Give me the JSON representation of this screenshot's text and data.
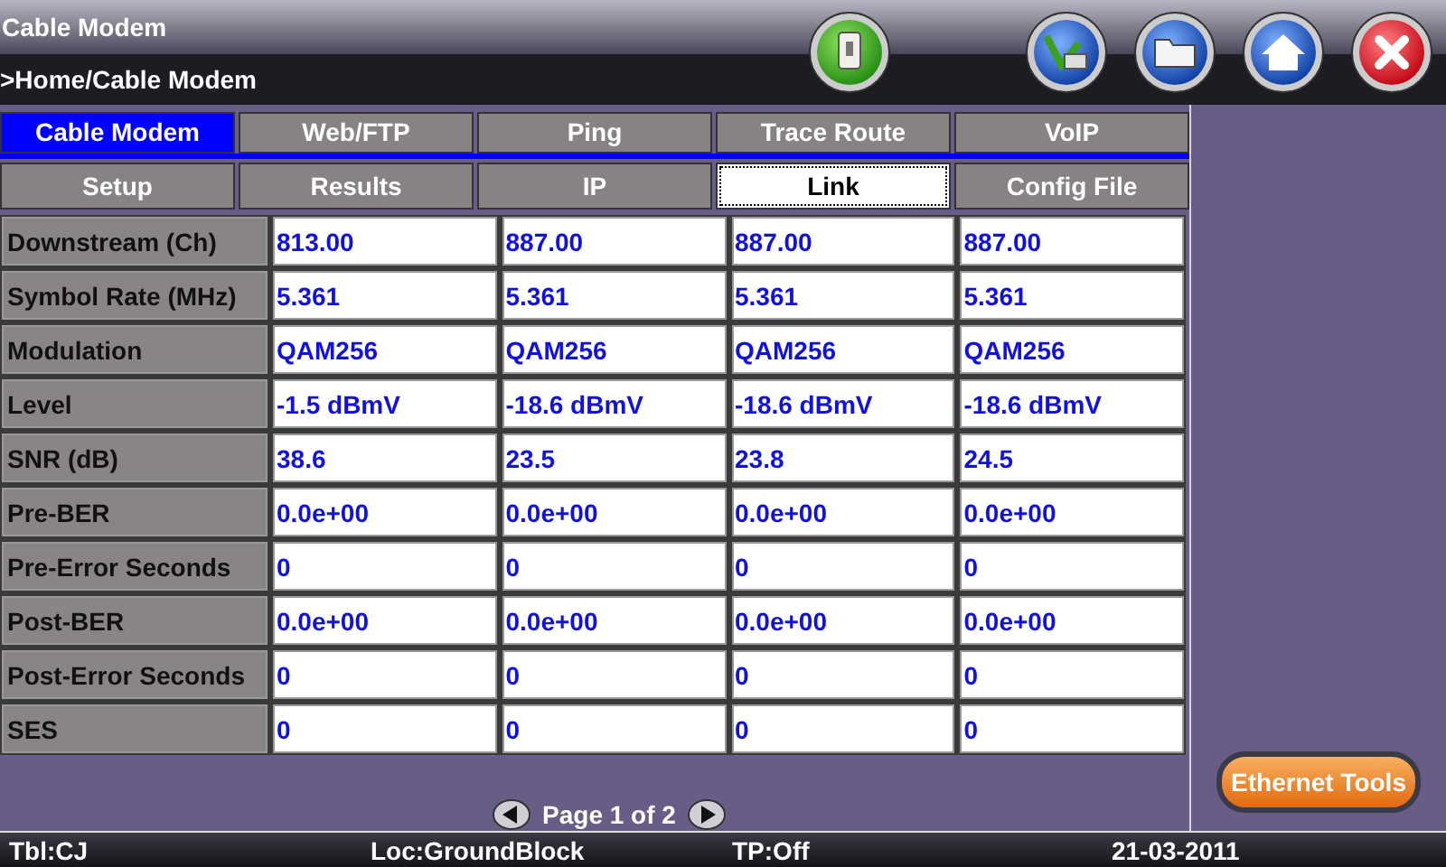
{
  "window": {
    "title": "Cable Modem",
    "breadcrumb": ">Home/Cable Modem"
  },
  "tabs": [
    {
      "label": "Cable Modem",
      "selected": true
    },
    {
      "label": "Web/FTP",
      "selected": false
    },
    {
      "label": "Ping",
      "selected": false
    },
    {
      "label": "Trace Route",
      "selected": false
    },
    {
      "label": "VoIP",
      "selected": false
    }
  ],
  "subtabs": [
    {
      "label": "Setup",
      "selected": false
    },
    {
      "label": "Results",
      "selected": false
    },
    {
      "label": "IP",
      "selected": false
    },
    {
      "label": "Link",
      "selected": true
    },
    {
      "label": "Config File",
      "selected": false
    }
  ],
  "table": {
    "rows": [
      {
        "label": "Downstream (Ch)",
        "cells": [
          "813.00",
          "887.00",
          "887.00",
          "887.00"
        ]
      },
      {
        "label": "Symbol Rate (MHz)",
        "cells": [
          "5.361",
          "5.361",
          "5.361",
          "5.361"
        ]
      },
      {
        "label": "Modulation",
        "cells": [
          "QAM256",
          "QAM256",
          "QAM256",
          "QAM256"
        ]
      },
      {
        "label": "Level",
        "cells": [
          "-1.5 dBmV",
          "-18.6 dBmV",
          "-18.6 dBmV",
          "-18.6 dBmV"
        ]
      },
      {
        "label": "SNR (dB)",
        "cells": [
          "38.6",
          "23.5",
          "23.8",
          "24.5"
        ]
      },
      {
        "label": "Pre-BER",
        "cells": [
          "0.0e+00",
          "0.0e+00",
          "0.0e+00",
          "0.0e+00"
        ]
      },
      {
        "label": "Pre-Error Seconds",
        "cells": [
          "0",
          "0",
          "0",
          "0"
        ]
      },
      {
        "label": "Post-BER",
        "cells": [
          "0.0e+00",
          "0.0e+00",
          "0.0e+00",
          "0.0e+00"
        ]
      },
      {
        "label": "Post-Error Seconds",
        "cells": [
          "0",
          "0",
          "0",
          "0"
        ]
      },
      {
        "label": "SES",
        "cells": [
          "0",
          "0",
          "0",
          "0"
        ]
      }
    ]
  },
  "pagination": {
    "text": "Page 1 of 2"
  },
  "ethernet_button": "Ethernet Tools",
  "status_bar": {
    "table": "Tbl:CJ",
    "location": "Loc:GroundBlock",
    "tp": "TP:Off",
    "date": "21-03-2011"
  }
}
